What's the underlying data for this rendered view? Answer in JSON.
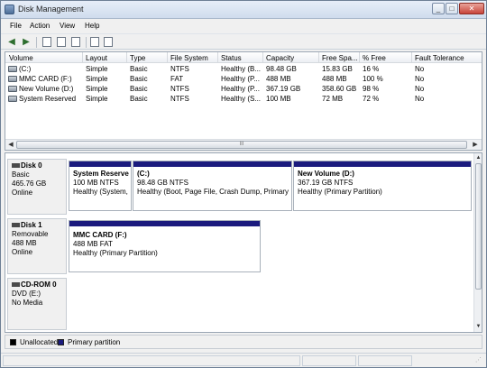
{
  "window": {
    "title": "Disk Management"
  },
  "menu": [
    "File",
    "Action",
    "View",
    "Help"
  ],
  "volume_list": {
    "columns": [
      "Volume",
      "Layout",
      "Type",
      "File System",
      "Status",
      "Capacity",
      "Free Spa...",
      "% Free",
      "Fault Tolerance"
    ],
    "rows": [
      [
        "(C:)",
        "Simple",
        "Basic",
        "NTFS",
        "Healthy (B...",
        "98.48 GB",
        "15.83 GB",
        "16 %",
        "No"
      ],
      [
        "MMC CARD (F:)",
        "Simple",
        "Basic",
        "FAT",
        "Healthy (P...",
        "488 MB",
        "488 MB",
        "100 %",
        "No"
      ],
      [
        "New Volume (D:)",
        "Simple",
        "Basic",
        "NTFS",
        "Healthy (P...",
        "367.19 GB",
        "358.60 GB",
        "98 %",
        "No"
      ],
      [
        "System Reserved",
        "Simple",
        "Basic",
        "NTFS",
        "Healthy (S...",
        "100 MB",
        "72 MB",
        "72 %",
        "No"
      ]
    ],
    "scroll_thumb_text": "III"
  },
  "disks": [
    {
      "name": "Disk 0",
      "type": "Basic",
      "size": "465.76 GB",
      "status": "Online",
      "partitions": [
        {
          "name": "System Reserved",
          "detail": "100 MB NTFS",
          "status": "Healthy (System,"
        },
        {
          "name": "(C:)",
          "detail": "98.48 GB NTFS",
          "status": "Healthy (Boot, Page File, Crash Dump, Primary P"
        },
        {
          "name": "New Volume  (D:)",
          "detail": "367.19 GB NTFS",
          "status": "Healthy (Primary Partition)"
        }
      ]
    },
    {
      "name": "Disk 1",
      "type": "Removable",
      "size": "488 MB",
      "status": "Online",
      "partitions": [
        {
          "name": "MMC CARD  (F:)",
          "detail": "488 MB FAT",
          "status": "Healthy (Primary Partition)"
        }
      ]
    },
    {
      "name": "CD-ROM 0",
      "type": "DVD (E:)",
      "size": "",
      "status": "No Media",
      "partitions": []
    }
  ],
  "legend": [
    {
      "label": "Unallocated",
      "color": "#000000"
    },
    {
      "label": "Primary partition",
      "color": "#1b1b7e"
    }
  ],
  "colors": {
    "primary_partition": "#1b1b7e",
    "unallocated": "#000000"
  }
}
